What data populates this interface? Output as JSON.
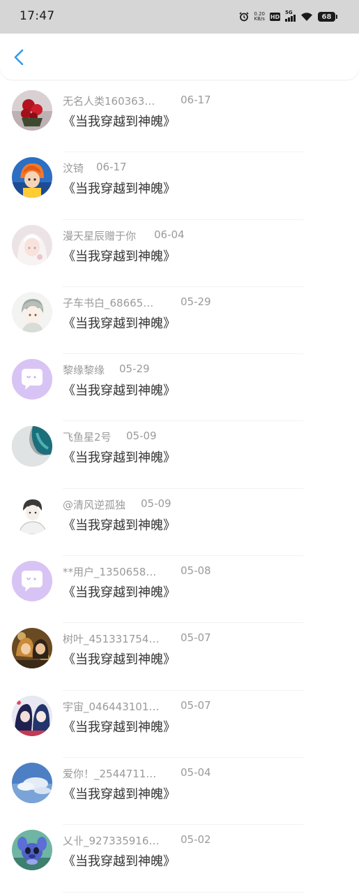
{
  "status_bar": {
    "time": "17:47",
    "net_speed_value": "0.20",
    "net_speed_unit": "KB/s",
    "hd_label": "HD",
    "network_label": "5G",
    "battery": "68"
  },
  "colors": {
    "accent": "#2e9bf0",
    "bot_avatar_bg": "#d8c4f4",
    "username": "#9a9a9a",
    "comment_text": "#333333"
  },
  "comments": [
    {
      "user": "无名人类160363…",
      "date": "06-17",
      "text": "《当我穿越到神魄》",
      "avatar": "red-flowers"
    },
    {
      "user": "汶锜",
      "date": "06-17",
      "text": "《当我穿越到神魄》",
      "avatar": "anime-boy-orange"
    },
    {
      "user": "漫天星辰赠于你",
      "date": "06-04",
      "text": "《当我穿越到神魄》",
      "avatar": "anime-girl-white"
    },
    {
      "user": "子车书白_68665…",
      "date": "05-29",
      "text": "《当我穿越到神魄》",
      "avatar": "anime-boy-grey"
    },
    {
      "user": "黎缘黎缘",
      "date": "05-29",
      "text": "《当我穿越到神魄》",
      "avatar": "default-bot"
    },
    {
      "user": "飞鱼星2号",
      "date": "05-09",
      "text": "《当我穿越到神魄》",
      "avatar": "ocean-wave"
    },
    {
      "user": "@清风逆孤独",
      "date": "05-09",
      "text": "《当我穿越到神魄》",
      "avatar": "sketch-boy"
    },
    {
      "user": "**用户_1350658…",
      "date": "05-08",
      "text": "《当我穿越到神魄》",
      "avatar": "default-bot"
    },
    {
      "user": "树叶_451331754…",
      "date": "05-07",
      "text": "《当我穿越到神魄》",
      "avatar": "anime-pair-gold"
    },
    {
      "user": "宇宙_046443101…",
      "date": "05-07",
      "text": "《当我穿越到神魄》",
      "avatar": "anime-pair-blue"
    },
    {
      "user": "爱你！_2544711…",
      "date": "05-04",
      "text": "《当我穿越到神魄》",
      "avatar": "blue-sky"
    },
    {
      "user": "乂卝_927335916…",
      "date": "05-02",
      "text": "《当我穿越到神魄》",
      "avatar": "stitch-toy"
    }
  ]
}
